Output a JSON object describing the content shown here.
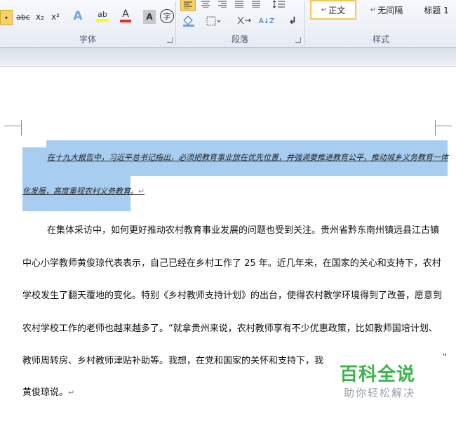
{
  "ribbon": {
    "font_group": {
      "label": "字体",
      "buttons": {
        "strikethrough": "abc",
        "subscript": "x₂",
        "superscript": "x²",
        "text_effect": "A",
        "highlight": "ab",
        "font_color": "A",
        "char_shading": "A",
        "enclose_char": "字"
      }
    },
    "paragraph_group": {
      "label": "段落",
      "sort": "A↓Z"
    },
    "styles_group": {
      "label": "样式",
      "items": [
        "正文",
        "无间隔",
        "标题 1"
      ],
      "prefix": "↵"
    },
    "colors": {
      "highlight": "#ffff00",
      "font_color": "#e03030"
    }
  },
  "document": {
    "selected_para": {
      "line1": "在十九大报告中，习近平总书记指出，必须把教育事业放在优先位置，并强调要推进教育公平，推动城乡义务教育一体",
      "line2": "化发展，高度重视农村义务教育。"
    },
    "para2": {
      "lines": [
        "在集体采访中，如何更好推动农村教育事业发展的问题也受到关注。贵州省黔东南州镇远县江古镇",
        "中心小学教师黄俊琼代表表示，自己已经在乡村工作了 25 年。近几年来，在国家的关心和支持下，农村",
        "学校发生了翻天覆地的变化。特别《乡村教师支持计划》的出台，使得农村教学环境得到了改善，愿意到",
        "农村学校工作的老师也越来越多了。“就拿贵州来说，农村教师享有不少优惠政策，比如教师国培计划、",
        "教师周转房、乡村教师津贴补助等。我想，在党和国家的关怀和支持下，我们",
        "黄俊琼说。"
      ],
      "trailing_quote": "”"
    },
    "paragraph_mark": "↵"
  },
  "watermark": {
    "title": "百科全说",
    "subtitle": "助你轻松解决"
  }
}
